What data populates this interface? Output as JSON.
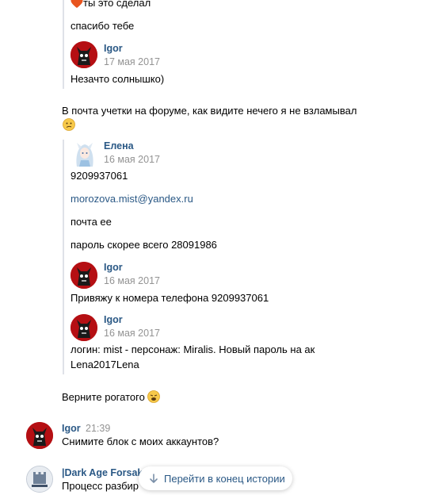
{
  "messages": {
    "top_line": "ты это сделал",
    "thanks": "спасибо тебе",
    "quote_igor_1": {
      "name": "Igor",
      "date": "17 мая 2017",
      "text": "Незачто солнышко)"
    },
    "emails_line1": "В почта учетки на форуме, как видите нечего я не взламывал",
    "elena_quote": {
      "name": "Елена",
      "date": "16 мая 2017",
      "phone": "9209937061",
      "email": "morozova.mist@yandex.ru",
      "mail_her": "почта ее",
      "password_line": "пароль скорее всего 28091986"
    },
    "quote_igor_2": {
      "name": "Igor",
      "date": "16 мая 2017",
      "text": "Привяжу к номера телефона 9209937061"
    },
    "quote_igor_3": {
      "name": "Igor",
      "date": "16 мая 2017",
      "text_line1": "логин: mist - персонаж: Miralis. Новый пароль на ак",
      "text_line2": "Lena2017Lena"
    },
    "return_horned": "Верните рогатого",
    "igor_msg": {
      "name": "Igor",
      "time": "21:39",
      "text": "Снимите блок с моих аккаунтов?"
    },
    "group_msg": {
      "name": "|Dark Age Forsak",
      "text": "Процесс разбир"
    }
  },
  "jump_button": {
    "label": "Перейти в конец истории",
    "icon": "arrow-down-icon"
  },
  "colors": {
    "link": "#2a5885",
    "date": "#939393",
    "quote_line": "#dfe2e8",
    "avatar_red": "#b50f13"
  }
}
